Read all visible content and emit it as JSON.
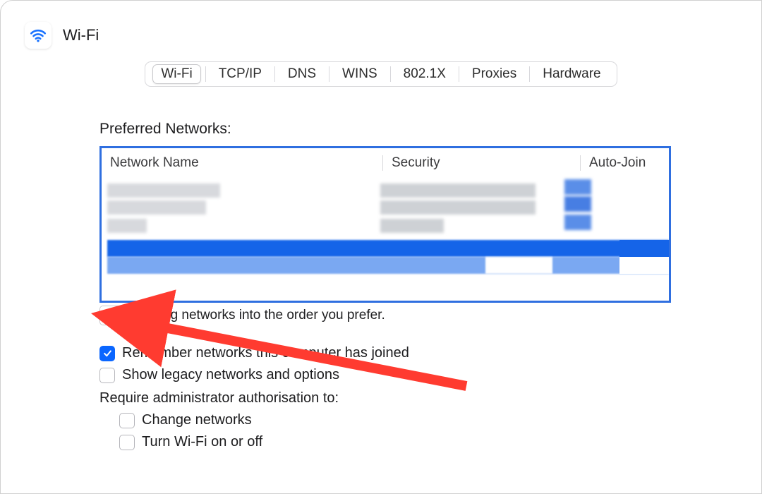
{
  "header": {
    "title": "Wi-Fi"
  },
  "tabs": [
    {
      "label": "Wi-Fi",
      "active": true
    },
    {
      "label": "TCP/IP",
      "active": false
    },
    {
      "label": "DNS",
      "active": false
    },
    {
      "label": "WINS",
      "active": false
    },
    {
      "label": "802.1X",
      "active": false
    },
    {
      "label": "Proxies",
      "active": false
    },
    {
      "label": "Hardware",
      "active": false
    }
  ],
  "preferred": {
    "section_label": "Preferred Networks:",
    "columns": {
      "name": "Network Name",
      "security": "Security",
      "autojoin": "Auto-Join"
    },
    "buttons": {
      "add": "+",
      "remove": "−"
    },
    "drag_hint": "ag networks into the order you prefer."
  },
  "checkboxes": {
    "remember": {
      "label": "Remember networks this computer has joined",
      "checked": true
    },
    "legacy": {
      "label": "Show legacy networks and options",
      "checked": false
    },
    "require_label": "Require administrator authorisation to:",
    "change": {
      "label": "Change networks",
      "checked": false
    },
    "toggle": {
      "label": "Turn Wi-Fi on or off",
      "checked": false
    }
  },
  "annotation": {
    "arrow_color": "#ff3b30"
  }
}
